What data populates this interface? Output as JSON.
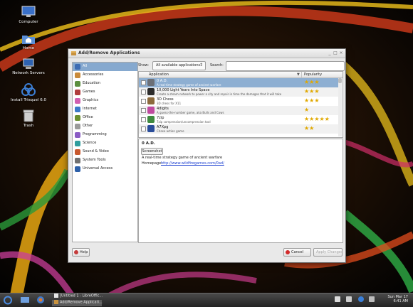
{
  "desktop": {
    "icons": [
      {
        "label": "Computer"
      },
      {
        "label": "Home"
      },
      {
        "label": "Network Servers"
      },
      {
        "label": "Install Trisquel 6.0"
      },
      {
        "label": "Trash"
      }
    ]
  },
  "window": {
    "title": "Add/Remove Applications",
    "controls": {
      "minimize": "_",
      "maximize": "□",
      "close": "×"
    }
  },
  "sidebar": {
    "categories": [
      {
        "label": "All",
        "color": "#3d6cb3"
      },
      {
        "label": "Accessories",
        "color": "#c98a3a"
      },
      {
        "label": "Education",
        "color": "#5b8e3e"
      },
      {
        "label": "Games",
        "color": "#b03c3c"
      },
      {
        "label": "Graphics",
        "color": "#d15fb1"
      },
      {
        "label": "Internet",
        "color": "#3b79c8"
      },
      {
        "label": "Office",
        "color": "#6a8f2f"
      },
      {
        "label": "Other",
        "color": "#9a9a9a"
      },
      {
        "label": "Programming",
        "color": "#8a5cc4"
      },
      {
        "label": "Science",
        "color": "#2f9d9d"
      },
      {
        "label": "Sound & Video",
        "color": "#c7582d"
      },
      {
        "label": "System Tools",
        "color": "#707070"
      },
      {
        "label": "Universal Access",
        "color": "#2c5fa8"
      }
    ]
  },
  "filter": {
    "show_label": "Show:",
    "show_value": "All available applications",
    "search_label": "Search:",
    "search_value": ""
  },
  "app_list": {
    "columns": [
      "Application",
      "Popularity"
    ],
    "rows": [
      {
        "name": "0 A.D.",
        "desc": "A real-time strategy game of ancient warfare",
        "stars": "★★★",
        "icon_color": "#6b6f77"
      },
      {
        "name": "10,000 Light Years Into Space",
        "desc": "Create a steam network to power a city and repair in time the damages that it will take",
        "stars": "★★★",
        "icon_color": "#2b2b2b"
      },
      {
        "name": "3D Chess",
        "desc": "3D chess for X11",
        "stars": "★★★",
        "icon_color": "#8c6a3c"
      },
      {
        "name": "4digits",
        "desc": "A guess-the-number game, aka Bulls and Cows",
        "stars": "★",
        "icon_color": "#c04aa0"
      },
      {
        "name": "7zip",
        "desc": "7zip compression/uncompression tool",
        "stars": "★★★★★",
        "icon_color": "#3f8a3f"
      },
      {
        "name": "A7Xpg",
        "desc": "Chase action game",
        "stars": "★★",
        "icon_color": "#2a4d9a"
      }
    ]
  },
  "details": {
    "name": "0 A.D.",
    "screenshot_label": "Screenshot",
    "description": "A real-time strategy game of ancient warfare",
    "homepage_label": "Homepage:",
    "homepage_url": "http://www.wildfiregames.com/0ad/"
  },
  "buttons": {
    "help": "Help",
    "cancel": "Cancel",
    "apply": "Apply Changes"
  },
  "taskbar": {
    "tasks": [
      {
        "label": "[Untitled 1 - LibreOffic..."
      },
      {
        "label": "Add/Remove Applicati..."
      }
    ],
    "clock": {
      "date": "Sun Mar 17",
      "time": "6:41 AM"
    }
  },
  "colors": {
    "selection": "#86a9cf",
    "star": "#e0a800",
    "link": "#1b3fd1"
  }
}
